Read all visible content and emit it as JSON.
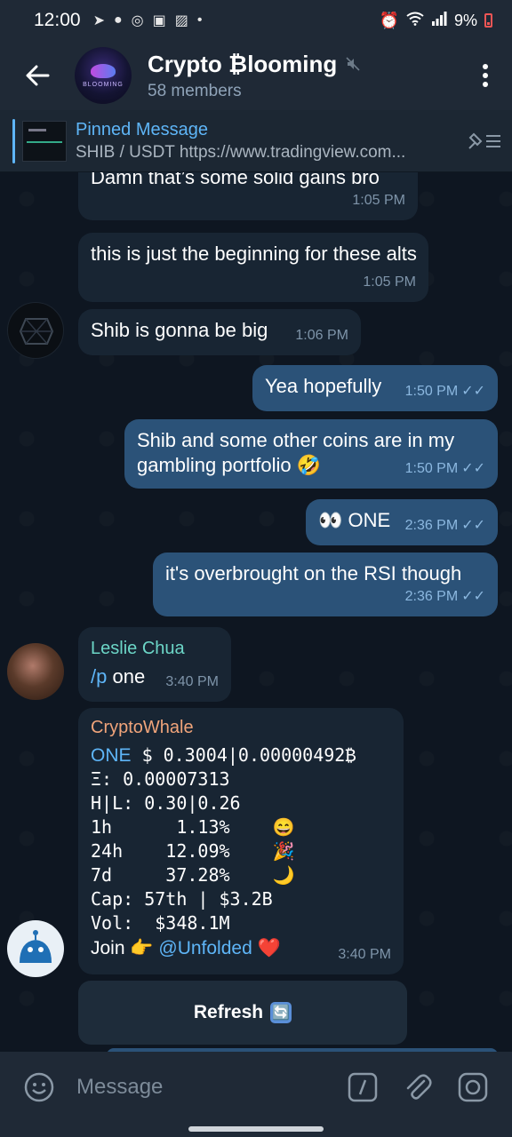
{
  "status_bar": {
    "time": "12:00",
    "battery": "9%"
  },
  "header": {
    "title": "Crypto ₿looming",
    "members": "58 members",
    "avatar_text": "BLOOMING"
  },
  "pinned": {
    "title": "Pinned Message",
    "text": "SHIB / USDT https://www.tradingview.com..."
  },
  "messages": [
    {
      "text": "Damn that’s some solid gains bro",
      "time": "1:05 PM"
    },
    {
      "text": "this is just the beginning for these alts",
      "time": "1:05 PM"
    },
    {
      "text": "Shib is gonna be big",
      "time": "1:06 PM"
    },
    {
      "text": "Yea hopefully",
      "time": "1:50 PM"
    },
    {
      "text": "Shib and some other coins are in my gambling portfolio 🤣",
      "time": "1:50 PM"
    },
    {
      "text": "👀 ONE",
      "time": "2:36 PM"
    },
    {
      "text": "it's overbrought on the RSI though",
      "time": "2:36 PM"
    },
    {
      "sender": "Leslie Chua",
      "command": "/p",
      "text": "one",
      "time": "3:40 PM"
    }
  ],
  "bot": {
    "sender": "CryptoWhale",
    "ticker": "ONE",
    "price_line": "$ 0.3004|0.00000492₿",
    "eth_line": "Ξ: 0.00007313",
    "hl_line": "H|L: 0.30|0.26",
    "rows": [
      {
        "text": "1h      1.13%",
        "emoji": "😄"
      },
      {
        "text": "24h    12.09%",
        "emoji": "🎉"
      },
      {
        "text": "7d     37.28%",
        "emoji": "🌙"
      }
    ],
    "cap_line": "Cap: 57th | $3.2B",
    "vol_line": "Vol:  $348.1M",
    "join_label": "Join",
    "join_emoji": "👉",
    "join_link": "@Unfolded",
    "join_heart": "❤️",
    "time": "3:40 PM",
    "refresh_label": "Refresh",
    "refresh_icon": "🔄"
  },
  "input": {
    "placeholder": "Message",
    "command_icon": "/"
  },
  "colors": {
    "accent": "#5eb5f7",
    "outgoing": "#2b5278",
    "incoming": "#182533",
    "leslie": "#6cd6c7",
    "whale": "#f0a47a"
  }
}
